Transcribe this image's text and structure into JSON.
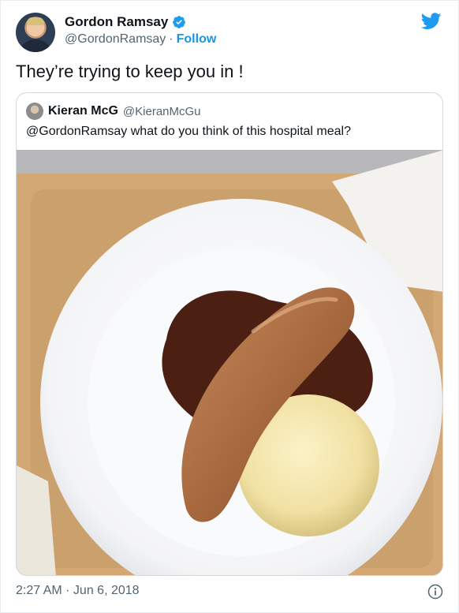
{
  "author": {
    "display_name": "Gordon Ramsay",
    "handle": "@GordonRamsay",
    "separator": "·",
    "follow_label": "Follow",
    "verified_icon": "verified-badge-icon",
    "brand_icon": "twitter-bird-icon"
  },
  "tweet": {
    "text": "They’re trying to keep you in !",
    "timestamp": "2:27 AM · Jun 6, 2018",
    "info_icon": "info-icon"
  },
  "quoted_tweet": {
    "display_name": "Kieran McG",
    "handle": "@KieranMcGu",
    "text": "@GordonRamsay what do you think of this hospital meal?"
  },
  "colors": {
    "link_blue": "#1b95e0",
    "text": "#0f1419",
    "muted": "#536471",
    "border": "#cfd9de"
  }
}
